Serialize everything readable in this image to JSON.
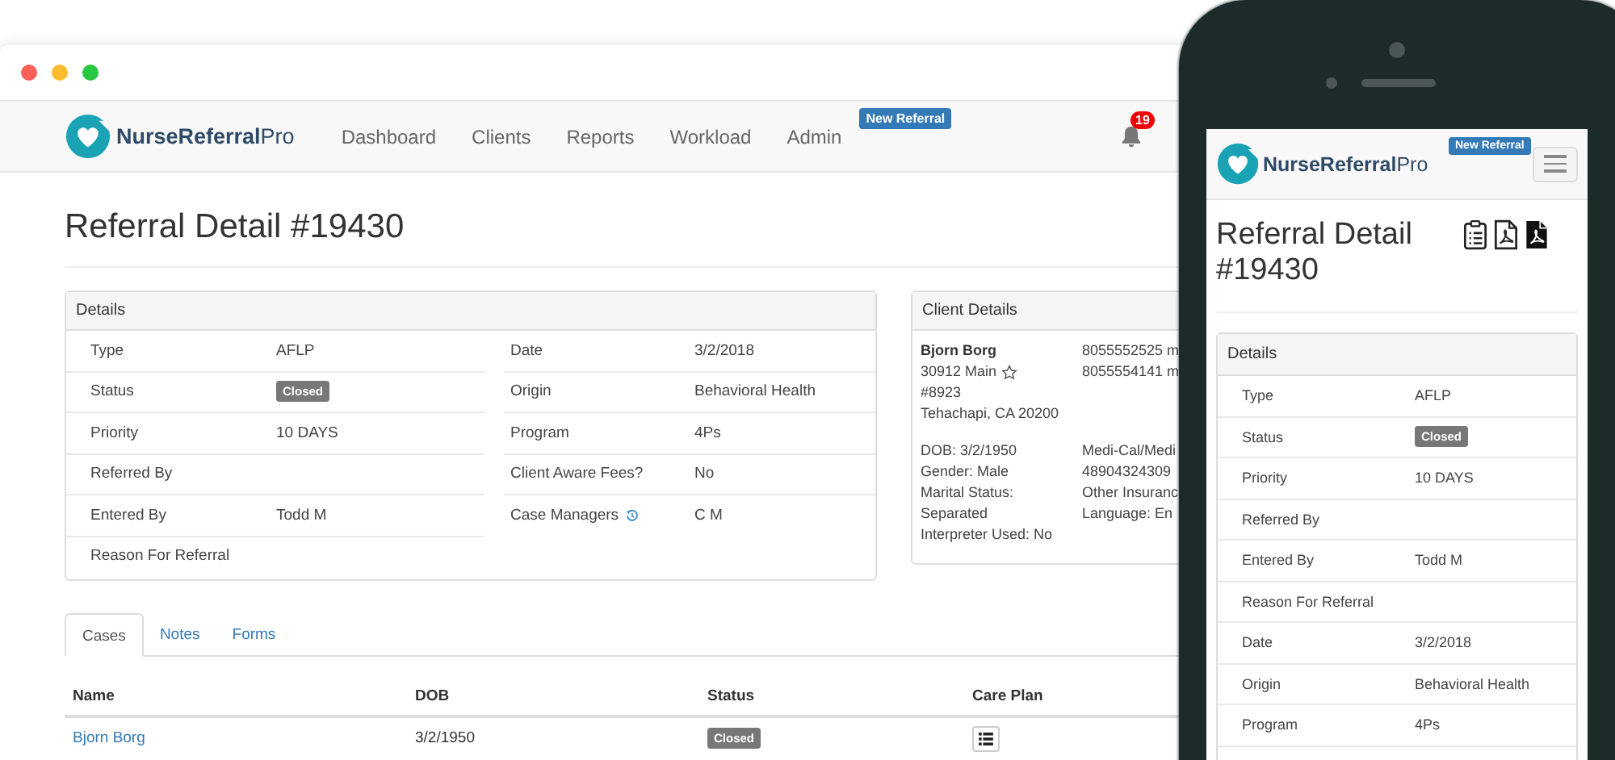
{
  "browser": {
    "nav": {
      "brand": "**NurseReferral**Pro",
      "items": [
        {
          "label": "Dashboard",
          "selected": false
        },
        {
          "label": "Clients",
          "selected": false
        },
        {
          "label": "Reports",
          "selected": false
        },
        {
          "label": "Workload",
          "selected": false
        },
        {
          "label": "Admin",
          "selected": false
        }
      ],
      "new_referral": "New Referral",
      "notification_count": "19"
    },
    "title": "Referral Detail #19430",
    "details": {
      "title": "Details",
      "left": [
        {
          "label": "Type",
          "value": "AFLP",
          "kind": "text"
        },
        {
          "label": "Status",
          "value": "Closed",
          "kind": "badge"
        },
        {
          "label": "Priority",
          "value": "10 DAYS",
          "kind": "text"
        },
        {
          "label": "Referred By",
          "kind": "text"
        },
        {
          "label": "Entered By",
          "value": "Todd M",
          "kind": "text"
        },
        {
          "label": "Reason For Referral",
          "kind": "text"
        }
      ],
      "right": [
        {
          "label": "Date",
          "value": "3/2/2018",
          "history_icon": false
        },
        {
          "label": "Origin",
          "value": "Behavioral Health",
          "history_icon": false
        },
        {
          "label": "Program",
          "value": "4Ps",
          "history_icon": false
        },
        {
          "label": "Client Aware Fees?",
          "value": "No",
          "history_icon": false
        },
        {
          "label": "Case Managers",
          "value": "C M",
          "history_icon": true
        }
      ]
    },
    "client": {
      "title": "Client Details",
      "contact": [
        {
          "text": "Bjorn Borg",
          "kind": "name"
        },
        {
          "text": "30912 Main",
          "kind": "address"
        },
        {
          "text": "#8923",
          "kind": "line"
        },
        {
          "text": "Tehachapi, CA 20200",
          "kind": "line"
        }
      ],
      "phones": [
        "8055552525 m",
        "8055554141 m"
      ],
      "info": [
        "DOB: 3/2/1950",
        "Gender: Male",
        "Marital Status: Separated",
        "Interpreter Used: No"
      ],
      "insurance": [
        "Medi-Cal/Medi",
        "48904324309",
        "Other Insuranc",
        "Language: En"
      ]
    },
    "tabs": [
      {
        "label": "Cases",
        "selected": true
      },
      {
        "label": "Notes",
        "selected": false
      },
      {
        "label": "Forms",
        "selected": false
      }
    ],
    "table": {
      "columns": [
        "Name",
        "DOB",
        "Status",
        "Care Plan"
      ],
      "rows": [
        {
          "name": "Bjorn Borg",
          "dob": "3/2/1950",
          "status": "Closed"
        }
      ]
    }
  },
  "phone": {
    "brand": "**NurseReferral**Pro",
    "new_referral": "New Referral",
    "title": "Referral Detail #19430",
    "details": {
      "title": "Details",
      "rows": [
        {
          "label": "Type",
          "value": "AFLP",
          "kind": "text"
        },
        {
          "label": "Status",
          "value": "Closed",
          "kind": "badge"
        },
        {
          "label": "Priority",
          "value": "10 DAYS",
          "kind": "text"
        },
        {
          "label": "Referred By",
          "kind": "text"
        },
        {
          "label": "Entered By",
          "value": "Todd M",
          "kind": "text"
        },
        {
          "label": "Reason For Referral",
          "kind": "text"
        },
        {
          "label": "Date",
          "value": "3/2/2018",
          "kind": "text"
        },
        {
          "label": "Origin",
          "value": "Behavioral Health",
          "kind": "text"
        },
        {
          "label": "Program",
          "value": "4Ps",
          "kind": "text"
        }
      ]
    }
  }
}
